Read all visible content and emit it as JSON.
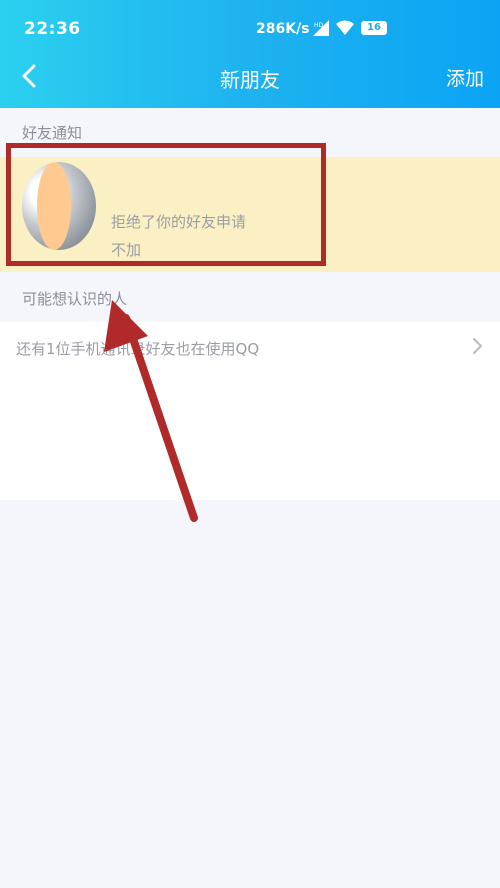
{
  "status_bar": {
    "time": "22:36",
    "net_speed": "286K/s",
    "battery_level": "16"
  },
  "header": {
    "title": "新朋友",
    "add_label": "添加"
  },
  "friend_notifications": {
    "section_label": "好友通知",
    "items": [
      {
        "message": "拒绝了你的好友申请",
        "status": "不加"
      }
    ]
  },
  "suggestions": {
    "section_label": "可能想认识的人",
    "contacts_text": "还有1位手机通讯录好友也在使用QQ"
  },
  "colors": {
    "header_gradient_start": "#2bd0ef",
    "header_gradient_end": "#0ba4f4",
    "highlight_row": "#faf0c4",
    "annotation_red": "#b02a2a"
  }
}
